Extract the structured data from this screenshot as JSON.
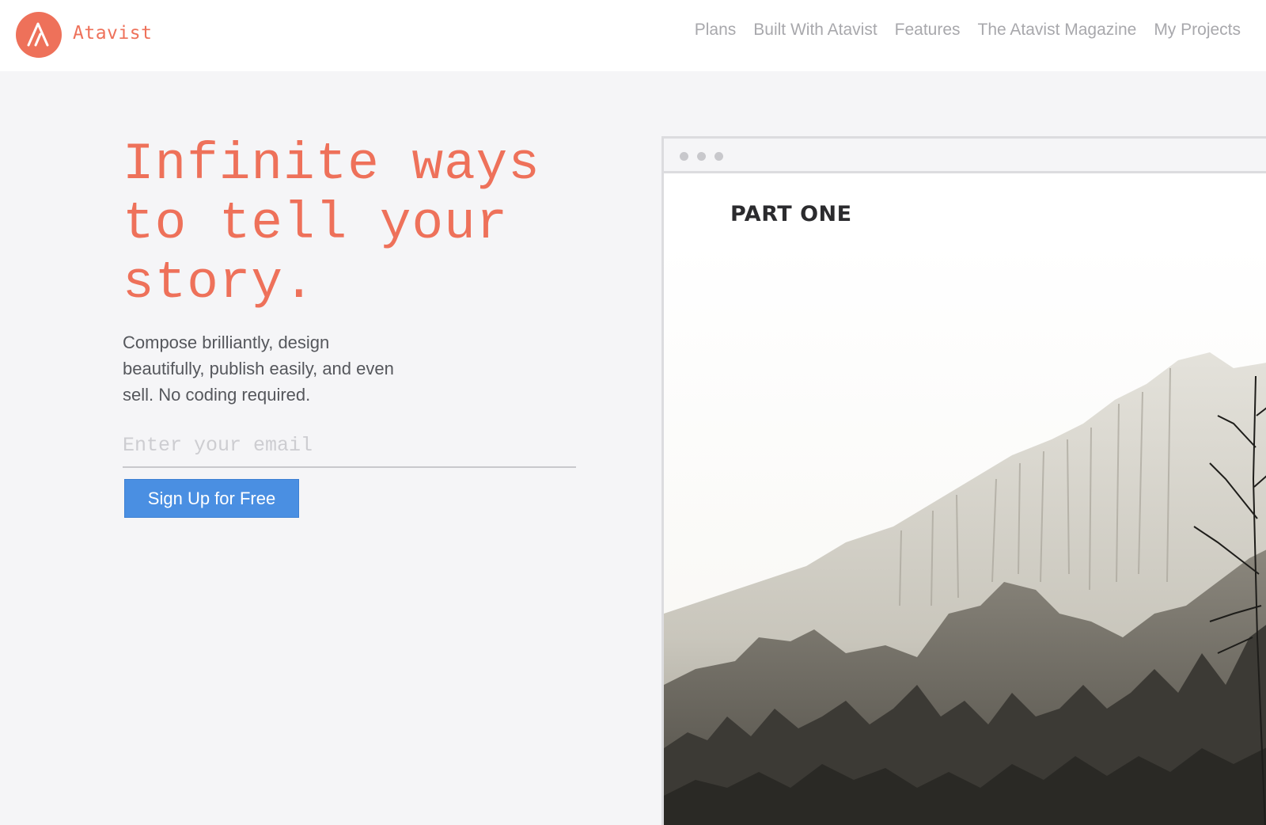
{
  "brand": {
    "name": "Atavist",
    "accent": "#ee715a"
  },
  "nav": {
    "items": [
      {
        "label": "Plans"
      },
      {
        "label": "Built With Atavist"
      },
      {
        "label": "Features"
      },
      {
        "label": "The Atavist Magazine"
      },
      {
        "label": "My Projects"
      }
    ]
  },
  "hero": {
    "headline_line1": "Infinite ways",
    "headline_line2": "to tell your",
    "headline_line3": "story.",
    "subtitle_line1": "Compose brilliantly, design",
    "subtitle_line2": "beautifully, publish easily, and even",
    "subtitle_line3": "sell. No coding required.",
    "email_placeholder": "Enter your email",
    "email_value": "",
    "cta_label": "Sign Up for Free",
    "cta_color": "#4a8fe2"
  },
  "preview": {
    "section_label": "PART ONE",
    "image_icon": "mountain-landscape-photo"
  }
}
